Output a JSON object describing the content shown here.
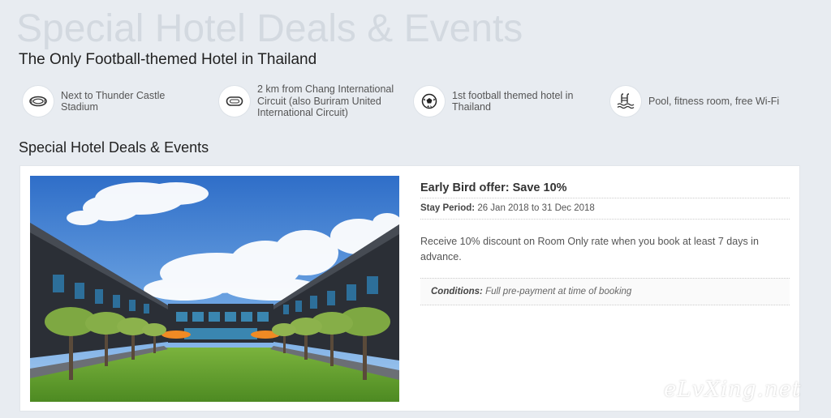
{
  "header": {
    "background_title": "Special Hotel Deals & Events",
    "subtitle": "The Only Football-themed Hotel in Thailand"
  },
  "features": [
    {
      "icon": "stadium-icon",
      "text": "Next to Thunder Castle Stadium"
    },
    {
      "icon": "race-circuit-icon",
      "text": "2 km from Chang International Circuit (also Buriram United International Circuit)"
    },
    {
      "icon": "football-icon",
      "text": "1st football themed hotel in Thailand"
    },
    {
      "icon": "pool-icon",
      "text": "Pool, fitness room, free Wi-Fi"
    }
  ],
  "section": {
    "heading": "Special Hotel Deals & Events"
  },
  "offer": {
    "title": "Early Bird offer: Save 10%",
    "stay_label": "Stay Period:",
    "stay_value": "26 Jan 2018 to 31 Dec 2018",
    "description": "Receive 10% discount on Room Only rate when you book at least 7 days in advance.",
    "conditions_label": "Conditions:",
    "conditions_value": "Full pre-payment at time of booking"
  },
  "watermark": "eLvXing.net",
  "colors": {
    "page_bg": "#e8ecf1",
    "card_bg": "#ffffff",
    "sky": "#3f7fcf",
    "lawn": "#5f9a2e"
  }
}
